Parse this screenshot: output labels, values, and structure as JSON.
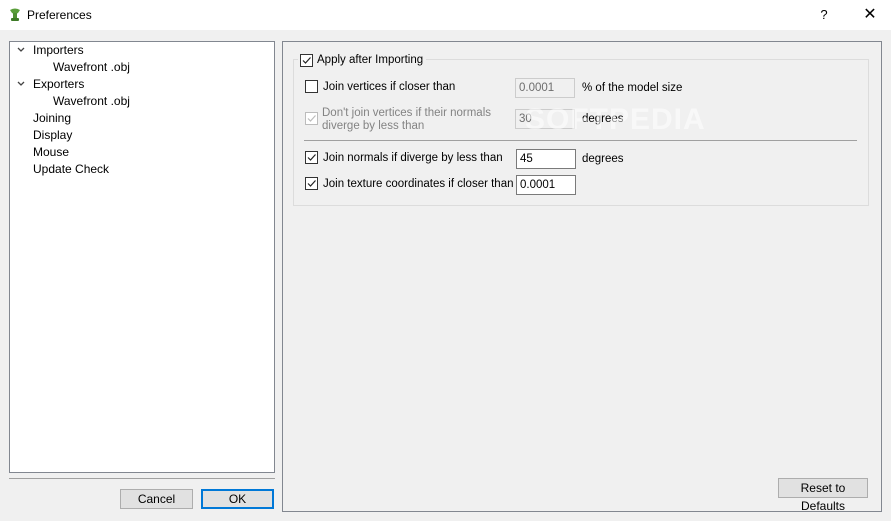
{
  "window": {
    "title": "Preferences",
    "help_label": "?",
    "close_label": "✕"
  },
  "tree": {
    "items": [
      {
        "label": "Importers",
        "expanded": true,
        "level": 0
      },
      {
        "label": "Wavefront .obj",
        "level": 1
      },
      {
        "label": "Exporters",
        "expanded": true,
        "level": 0
      },
      {
        "label": "Wavefront .obj",
        "level": 1
      },
      {
        "label": "Joining",
        "level": 0
      },
      {
        "label": "Display",
        "level": 0
      },
      {
        "label": "Mouse",
        "level": 0
      },
      {
        "label": "Update Check",
        "level": 0
      }
    ],
    "expand_glyph": "❯"
  },
  "buttons": {
    "cancel": "Cancel",
    "ok": "OK",
    "reset": "Reset to Defaults"
  },
  "settings": {
    "apply_after_importing": {
      "label": "Apply after Importing",
      "checked": true
    },
    "join_vertices": {
      "label": "Join vertices if closer than",
      "checked": false,
      "value": "0.0001",
      "unit": "% of the model size"
    },
    "dont_join_vertices": {
      "label_line1": "Don't join vertices if their normals",
      "label_line2": "diverge by less than",
      "checked": true,
      "disabled": true,
      "value": "30",
      "unit": "degrees"
    },
    "join_normals": {
      "label": "Join normals if diverge by less than",
      "checked": true,
      "value": "45",
      "unit": "degrees"
    },
    "join_texture": {
      "label": "Join texture coordinates if closer than",
      "checked": true,
      "value": "0.0001"
    }
  },
  "watermark": "SOFTPEDIA"
}
